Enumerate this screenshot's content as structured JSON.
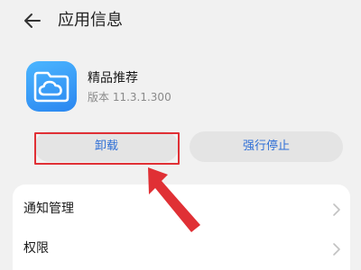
{
  "header": {
    "title": "应用信息",
    "back_icon": "back-arrow-icon"
  },
  "app": {
    "name": "精品推荐",
    "version": "版本 11.3.1.300",
    "icon": "cloud-folder-icon",
    "icon_color": "#3a9bf5"
  },
  "actions": {
    "uninstall_label": "卸载",
    "force_stop_label": "强行停止",
    "label_color": "#2f6fd6"
  },
  "settings": {
    "items": [
      {
        "label": "通知管理"
      },
      {
        "label": "权限"
      }
    ]
  },
  "annotation": {
    "highlight_color": "#e03035"
  }
}
